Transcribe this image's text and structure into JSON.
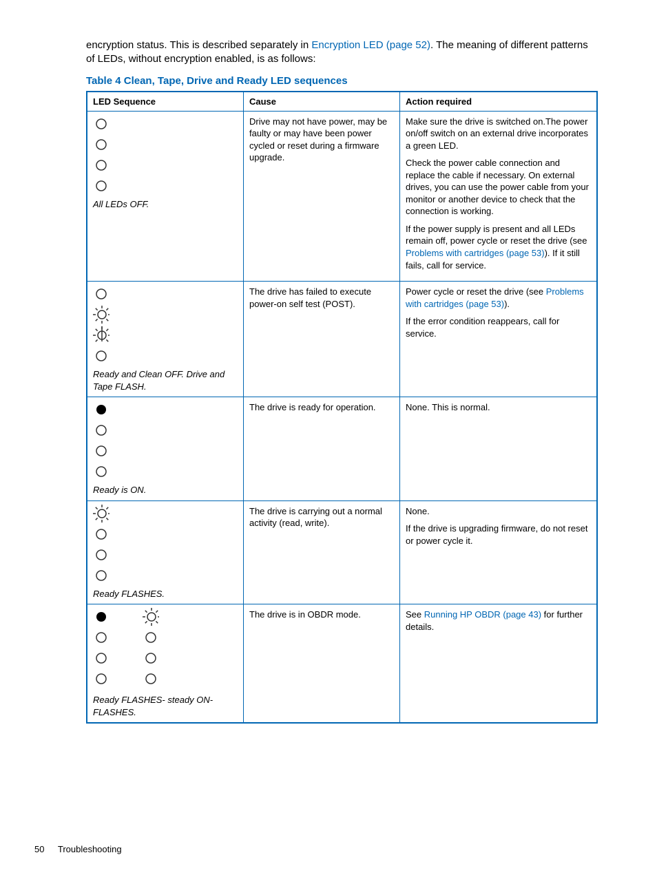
{
  "intro": {
    "before_link": "encryption status. This is described separately in ",
    "link_text": "Encryption LED (page 52)",
    "after_link": ". The meaning of different patterns of LEDs, without encryption enabled, is as follows:"
  },
  "table_title": "Table 4 Clean, Tape, Drive and Ready LED sequences",
  "headers": {
    "seq": "LED Sequence",
    "cause": "Cause",
    "action": "Action required"
  },
  "rows": [
    {
      "led_pattern": [
        "off",
        "off",
        "off",
        "off"
      ],
      "caption": "All LEDs OFF.",
      "cause": "Drive may not have power, may be faulty or may have been power cycled or reset during a firmware upgrade.",
      "action": {
        "p1": "Make sure the drive is switched on.The power on/off switch on an external drive incorporates a green LED.",
        "p2": "Check the power cable connection and replace the cable if necessary. On external drives, you can use the power cable from your monitor or another device to check that the connection is working.",
        "p3_before": "If the power supply is present and all LEDs remain off, power cycle or reset the drive (see ",
        "p3_link": "Problems with cartridges (page 53)",
        "p3_after": "). If it still fails, call for service."
      }
    },
    {
      "led_pattern": [
        "off",
        "flash",
        "flash",
        "off"
      ],
      "caption": "Ready and Clean OFF. Drive and Tape FLASH.",
      "cause": "The drive has failed to execute power-on self test (POST).",
      "action": {
        "p1_before": "Power cycle or reset the drive (see ",
        "p1_link": "Problems with cartridges (page 53)",
        "p1_after": ").",
        "p2": "If the error condition reappears, call for service."
      }
    },
    {
      "led_pattern": [
        "on",
        "off",
        "off",
        "off"
      ],
      "caption": "Ready is ON.",
      "cause": "The drive is ready for operation.",
      "action": {
        "p1": "None. This is normal."
      }
    },
    {
      "led_pattern": [
        "flash",
        "off",
        "off",
        "off"
      ],
      "caption": "Ready FLASHES.",
      "cause": "The drive is carrying out a normal activity (read, write).",
      "action": {
        "p1": "None.",
        "p2": "If the drive is upgrading firmware, do not reset or power cycle it."
      }
    },
    {
      "led_pattern_dual": {
        "left": [
          "on",
          "off",
          "off",
          "off"
        ],
        "right": [
          "flash",
          "off",
          "off",
          "off"
        ]
      },
      "caption": "Ready FLASHES- steady ON-FLASHES.",
      "cause": "The drive is in OBDR mode.",
      "action": {
        "p1_before": "See ",
        "p1_link": "Running HP OBDR (page 43)",
        "p1_after": " for further details."
      }
    }
  ],
  "footer": {
    "page": "50",
    "section": "Troubleshooting"
  }
}
